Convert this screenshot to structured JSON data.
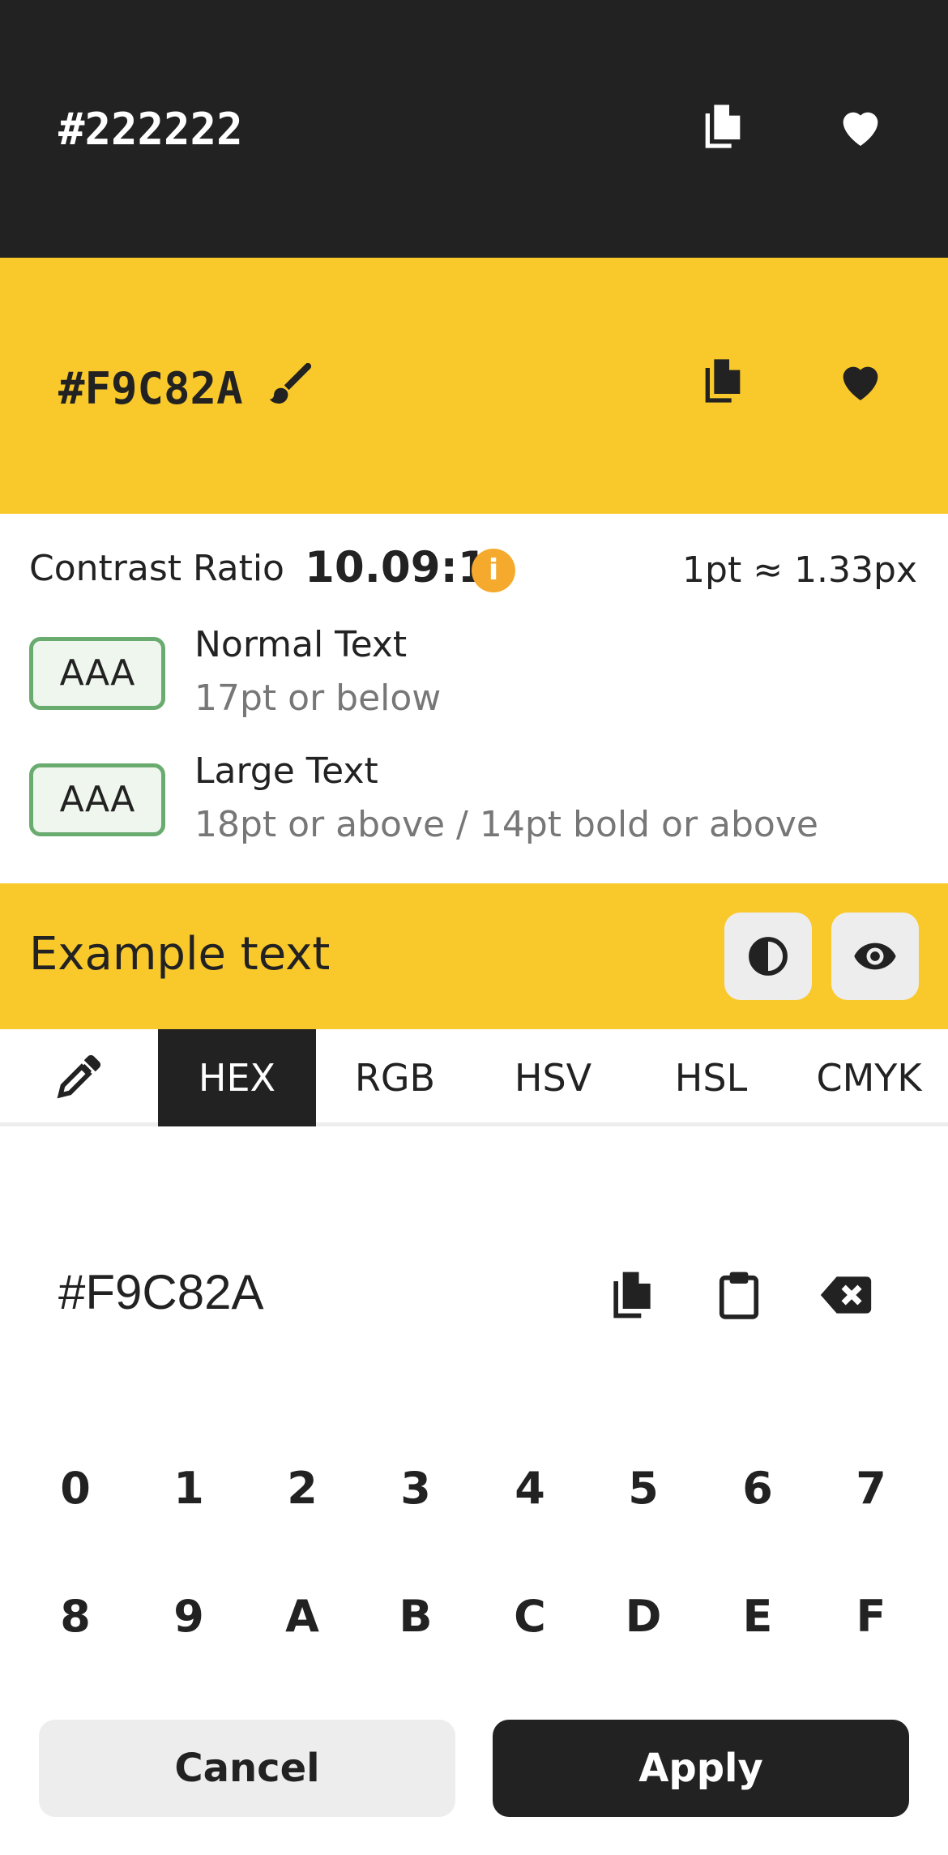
{
  "colors": {
    "foreground": "#222222",
    "background": "#F9C82A",
    "pass_border": "#6AAB70",
    "info": "#F5AA2E"
  },
  "foreground_panel": {
    "hex": "#222222",
    "icons": [
      "copy-icon",
      "heart-icon"
    ]
  },
  "background_panel": {
    "hex": "#F9C82A",
    "icons": [
      "brush-icon",
      "copy-icon",
      "heart-icon"
    ]
  },
  "contrast": {
    "label": "Contrast Ratio",
    "value": "10.09:1",
    "info_symbol": "i",
    "unit_note": "1pt ≈ 1.33px",
    "rows": [
      {
        "badge": "AAA",
        "title": "Normal Text",
        "subtitle": "17pt or below"
      },
      {
        "badge": "AAA",
        "title": "Large Text",
        "subtitle": "18pt or above / 14pt bold or above"
      }
    ]
  },
  "example": {
    "text": "Example text",
    "icons": [
      "contrast-icon",
      "eye-icon"
    ]
  },
  "tabs": [
    "HEX",
    "RGB",
    "HSV",
    "HSL",
    "CMYK"
  ],
  "active_tab": "HEX",
  "input": {
    "value": "#F9C82A",
    "icons": [
      "copy-icon",
      "clipboard-icon",
      "backspace-icon"
    ]
  },
  "keypad": {
    "row1": [
      "0",
      "1",
      "2",
      "3",
      "4",
      "5",
      "6",
      "7"
    ],
    "row2": [
      "8",
      "9",
      "A",
      "B",
      "C",
      "D",
      "E",
      "F"
    ]
  },
  "buttons": {
    "cancel": "Cancel",
    "apply": "Apply"
  }
}
